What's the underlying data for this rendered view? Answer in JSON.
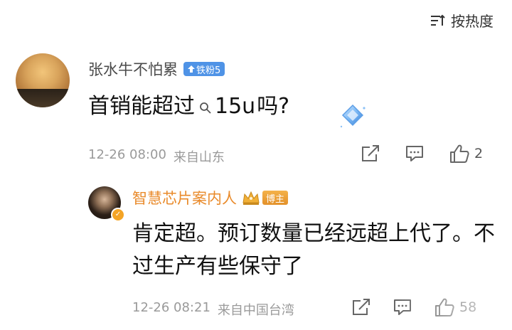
{
  "sort": {
    "label": "按热度",
    "icon": "sort-icon"
  },
  "main_comment": {
    "username": "张水牛不怕累",
    "fan_badge": "铁粉5",
    "text_before": "首销能超过",
    "text_link": "15u",
    "text_after": "吗?",
    "timestamp": "12-26 08:00",
    "location": "来自山东",
    "like_count": "2",
    "icons": [
      "share-icon",
      "comment-icon",
      "like-icon",
      "diamond-sticker-icon"
    ]
  },
  "reply": {
    "username": "智慧芯片案内人",
    "badge": "博主",
    "text": "肯定超。预订数量已经远超上代了。不过生产有些保守了",
    "timestamp": "12-26 08:21",
    "location": "来自中国台湾",
    "like_count": "58",
    "icons": [
      "crown-icon",
      "verified-icon",
      "share-icon",
      "comment-icon",
      "like-icon"
    ]
  },
  "colors": {
    "fan_badge": "#4f93e6",
    "reply_username": "#e98a2a",
    "meta_text": "#9a9a9a"
  }
}
